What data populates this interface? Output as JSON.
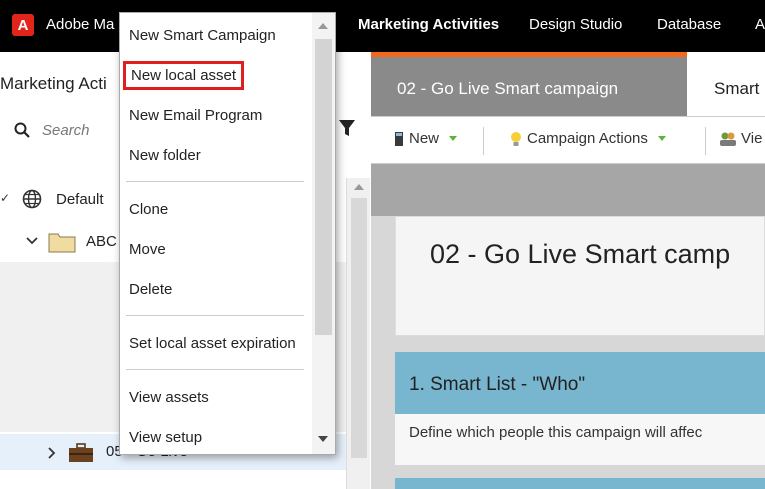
{
  "topbar": {
    "brand": "Adobe Ma",
    "nav": [
      "Marketing Activities",
      "Design Studio",
      "Database",
      "A"
    ]
  },
  "sidebar": {
    "title": "Marketing Acti",
    "search_placeholder": "Search",
    "tree": [
      {
        "label": "Default",
        "icon": "globe-icon"
      },
      {
        "label": "ABC",
        "icon": "folder-icon"
      },
      {
        "label": "05 - Go Live",
        "icon": "briefcase-icon"
      }
    ]
  },
  "context_menu": {
    "items": [
      "New Smart Campaign",
      "New local asset",
      "New Email Program",
      "New folder",
      "Clone",
      "Move",
      "Delete",
      "Set local asset expiration",
      "View assets",
      "View setup"
    ],
    "highlighted": "New local asset"
  },
  "main": {
    "tabs": [
      "02 - Go Live Smart campaign",
      "Smart"
    ],
    "toolbar": [
      "New",
      "Campaign Actions",
      "Vie"
    ],
    "heading": "02 - Go Live Smart camp",
    "smart_list_title": "1. Smart List - \"Who\"",
    "smart_list_desc": "Define which people this campaign will affec"
  },
  "colors": {
    "accent_orange": "#f2691e",
    "highlight_red": "#e01e1e",
    "card_blue": "#78b6cf",
    "logo_red": "#e1251b"
  }
}
